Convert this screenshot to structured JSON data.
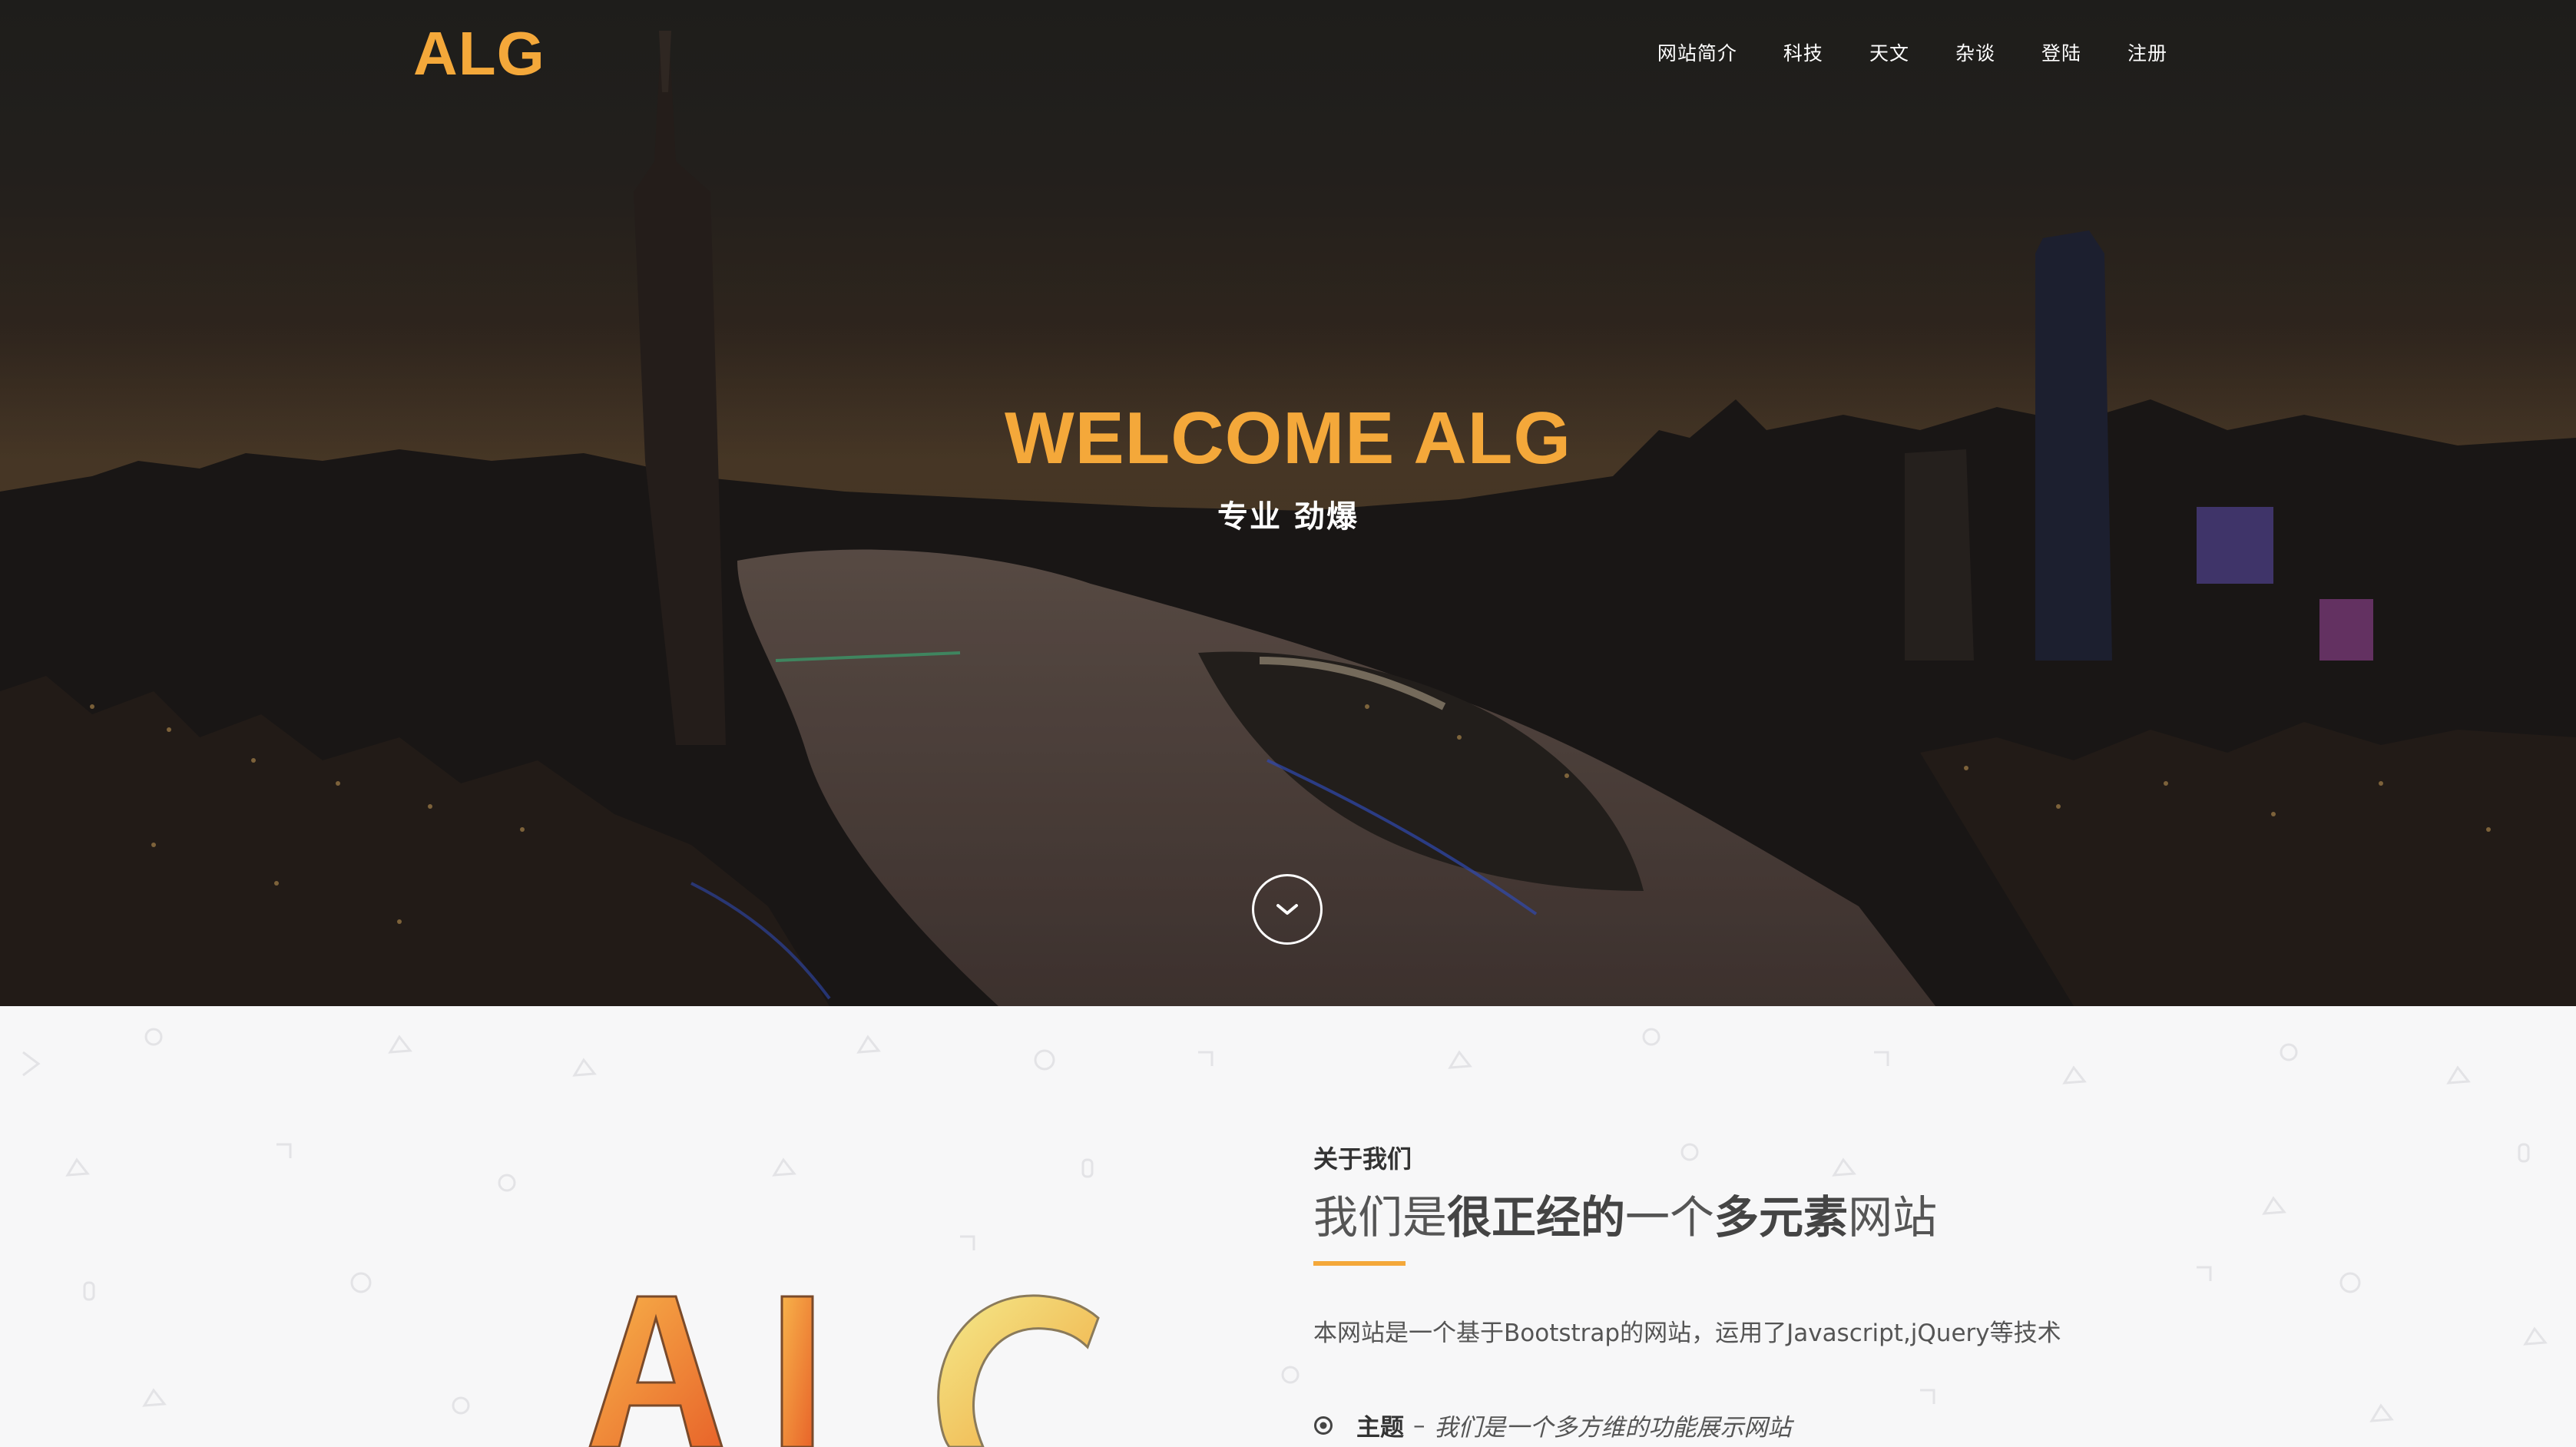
{
  "header": {
    "brand": "ALG",
    "nav": [
      "网站简介",
      "科技",
      "天文",
      "杂谈",
      "登陆",
      "注册"
    ]
  },
  "hero": {
    "title": "WELCOME ALG",
    "subtitle": "专业 劲爆",
    "scroll_icon": "chevron-down-icon"
  },
  "about": {
    "label": "关于我们",
    "heading": {
      "part1": "我们是",
      "part2": "很正经的",
      "part3": "一个",
      "part4": "多元素",
      "part5": "网站"
    },
    "description": "本网站是一个基于Bootstrap的网站，运用了Javascript,jQuery等技术",
    "features": [
      {
        "icon": "target-icon",
        "title": "主题",
        "separator": "–",
        "desc": "我们是一个多方维的功能展示网站"
      }
    ],
    "logo_text": "ALG"
  },
  "colors": {
    "accent": "#f4a83a",
    "background": "#f7f7f8",
    "hero_text": "#ffffff"
  }
}
